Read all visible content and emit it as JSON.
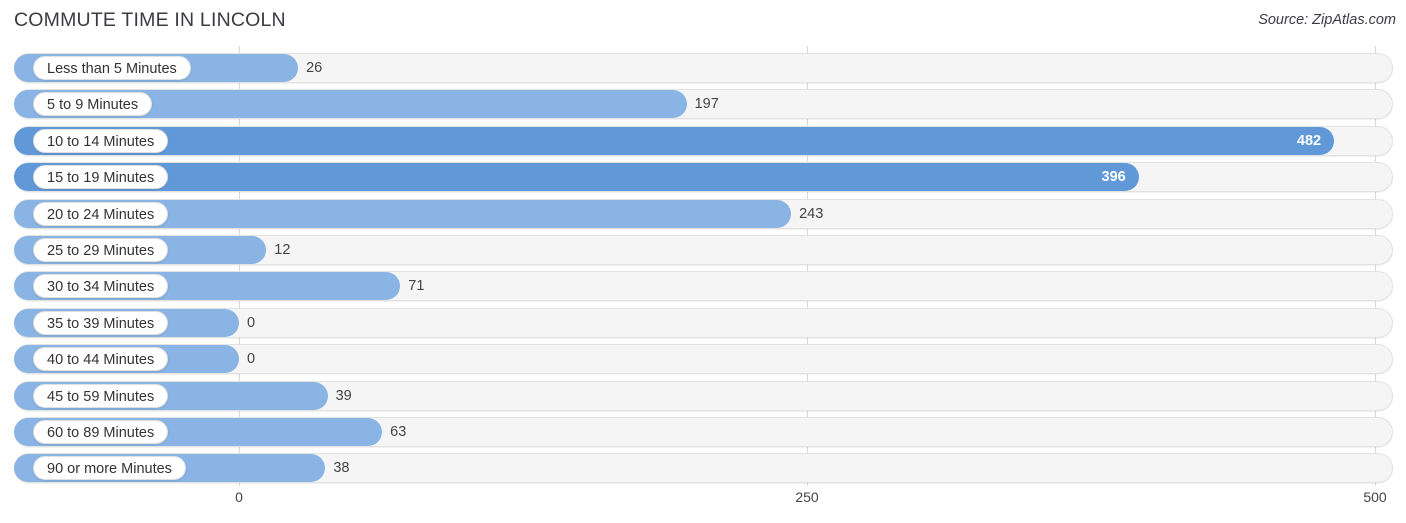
{
  "header": {
    "title": "COMMUTE TIME IN LINCOLN",
    "source": "Source: ZipAtlas.com"
  },
  "colors": {
    "bar_light": "#8ab4e4",
    "bar_dark": "#6199d8",
    "track": "#f5f5f5",
    "track_border": "#e2e2e2",
    "gridline": "#d8d8d8",
    "text": "#333333",
    "value_inside": "#ffffff"
  },
  "chart_data": {
    "type": "bar",
    "orientation": "horizontal",
    "title": "COMMUTE TIME IN LINCOLN",
    "xlabel": "",
    "ylabel": "",
    "xlim": [
      0,
      500
    ],
    "xticks": [
      "0",
      "250",
      "500"
    ],
    "xtick_values": [
      0,
      250,
      500
    ],
    "grid": true,
    "legend": false,
    "categories": [
      "Less than 5 Minutes",
      "5 to 9 Minutes",
      "10 to 14 Minutes",
      "15 to 19 Minutes",
      "20 to 24 Minutes",
      "25 to 29 Minutes",
      "30 to 34 Minutes",
      "35 to 39 Minutes",
      "40 to 44 Minutes",
      "45 to 59 Minutes",
      "60 to 89 Minutes",
      "90 or more Minutes"
    ],
    "values": [
      26,
      197,
      482,
      396,
      243,
      12,
      71,
      0,
      0,
      39,
      63,
      38
    ],
    "value_labels": [
      "26",
      "197",
      "482",
      "396",
      "243",
      "12",
      "71",
      "0",
      "0",
      "39",
      "63",
      "38"
    ]
  },
  "rows": [
    {
      "label": "Less than 5 Minutes",
      "value": 26,
      "value_label": "26",
      "shade": "light",
      "inside": false
    },
    {
      "label": "5 to 9 Minutes",
      "value": 197,
      "value_label": "197",
      "shade": "light",
      "inside": false
    },
    {
      "label": "10 to 14 Minutes",
      "value": 482,
      "value_label": "482",
      "shade": "dark",
      "inside": true
    },
    {
      "label": "15 to 19 Minutes",
      "value": 396,
      "value_label": "396",
      "shade": "dark",
      "inside": true
    },
    {
      "label": "20 to 24 Minutes",
      "value": 243,
      "value_label": "243",
      "shade": "light",
      "inside": false
    },
    {
      "label": "25 to 29 Minutes",
      "value": 12,
      "value_label": "12",
      "shade": "light",
      "inside": false
    },
    {
      "label": "30 to 34 Minutes",
      "value": 71,
      "value_label": "71",
      "shade": "light",
      "inside": false
    },
    {
      "label": "35 to 39 Minutes",
      "value": 0,
      "value_label": "0",
      "shade": "light",
      "inside": false
    },
    {
      "label": "40 to 44 Minutes",
      "value": 0,
      "value_label": "0",
      "shade": "light",
      "inside": false
    },
    {
      "label": "45 to 59 Minutes",
      "value": 39,
      "value_label": "39",
      "shade": "light",
      "inside": false
    },
    {
      "label": "60 to 89 Minutes",
      "value": 63,
      "value_label": "63",
      "shade": "light",
      "inside": false
    },
    {
      "label": "90 or more Minutes",
      "value": 38,
      "value_label": "38",
      "shade": "light",
      "inside": false
    }
  ],
  "axis": {
    "ticks": [
      {
        "label": "0",
        "value": 0
      },
      {
        "label": "250",
        "value": 250
      },
      {
        "label": "500",
        "value": 500
      }
    ]
  }
}
